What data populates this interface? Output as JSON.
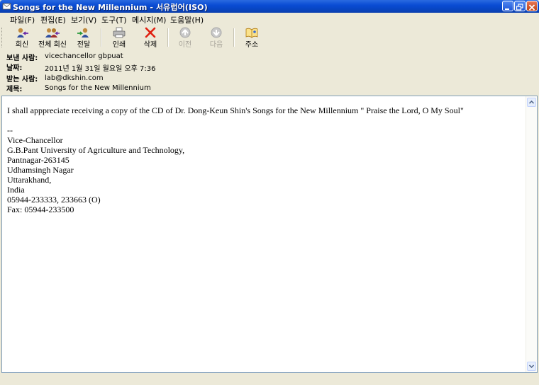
{
  "window": {
    "title": "Songs for the New Millennium - 서유럽어(ISO)"
  },
  "menu": [
    {
      "label": "파일(F)"
    },
    {
      "label": "편집(E)"
    },
    {
      "label": "보기(V)"
    },
    {
      "label": "도구(T)"
    },
    {
      "label": "메시지(M)"
    },
    {
      "label": "도움말(H)"
    }
  ],
  "toolbar": {
    "reply": "회신",
    "reply_all": "전체 회신",
    "forward": "전달",
    "print": "인쇄",
    "delete": "삭제",
    "previous": "이전",
    "next": "다음",
    "addresses": "주소"
  },
  "header": {
    "from_label": "보낸 사람:",
    "from_value": "vicechancellor gbpuat",
    "date_label": "날짜:",
    "date_value": "2011년 1월 31일 월요일 오후 7:36",
    "to_label": "받는 사람:",
    "to_value": "lab@dkshin.com",
    "subject_label": "제목:",
    "subject_value": "Songs for the New Millennium"
  },
  "body": {
    "lines": [
      "I shall apppreciate receiving a copy of  the CD  of Dr. Dong-Keun Shin's Songs for the New Millennium  \" Praise the Lord, O My Soul\"",
      "",
      "--",
      "Vice-Chancellor",
      "G.B.Pant University of Agriculture and Technology,",
      "Pantnagar-263145",
      "Udhamsingh Nagar",
      "Uttarakhand,",
      "India",
      "05944-233333, 233663 (O)",
      "Fax: 05944-233500"
    ]
  }
}
